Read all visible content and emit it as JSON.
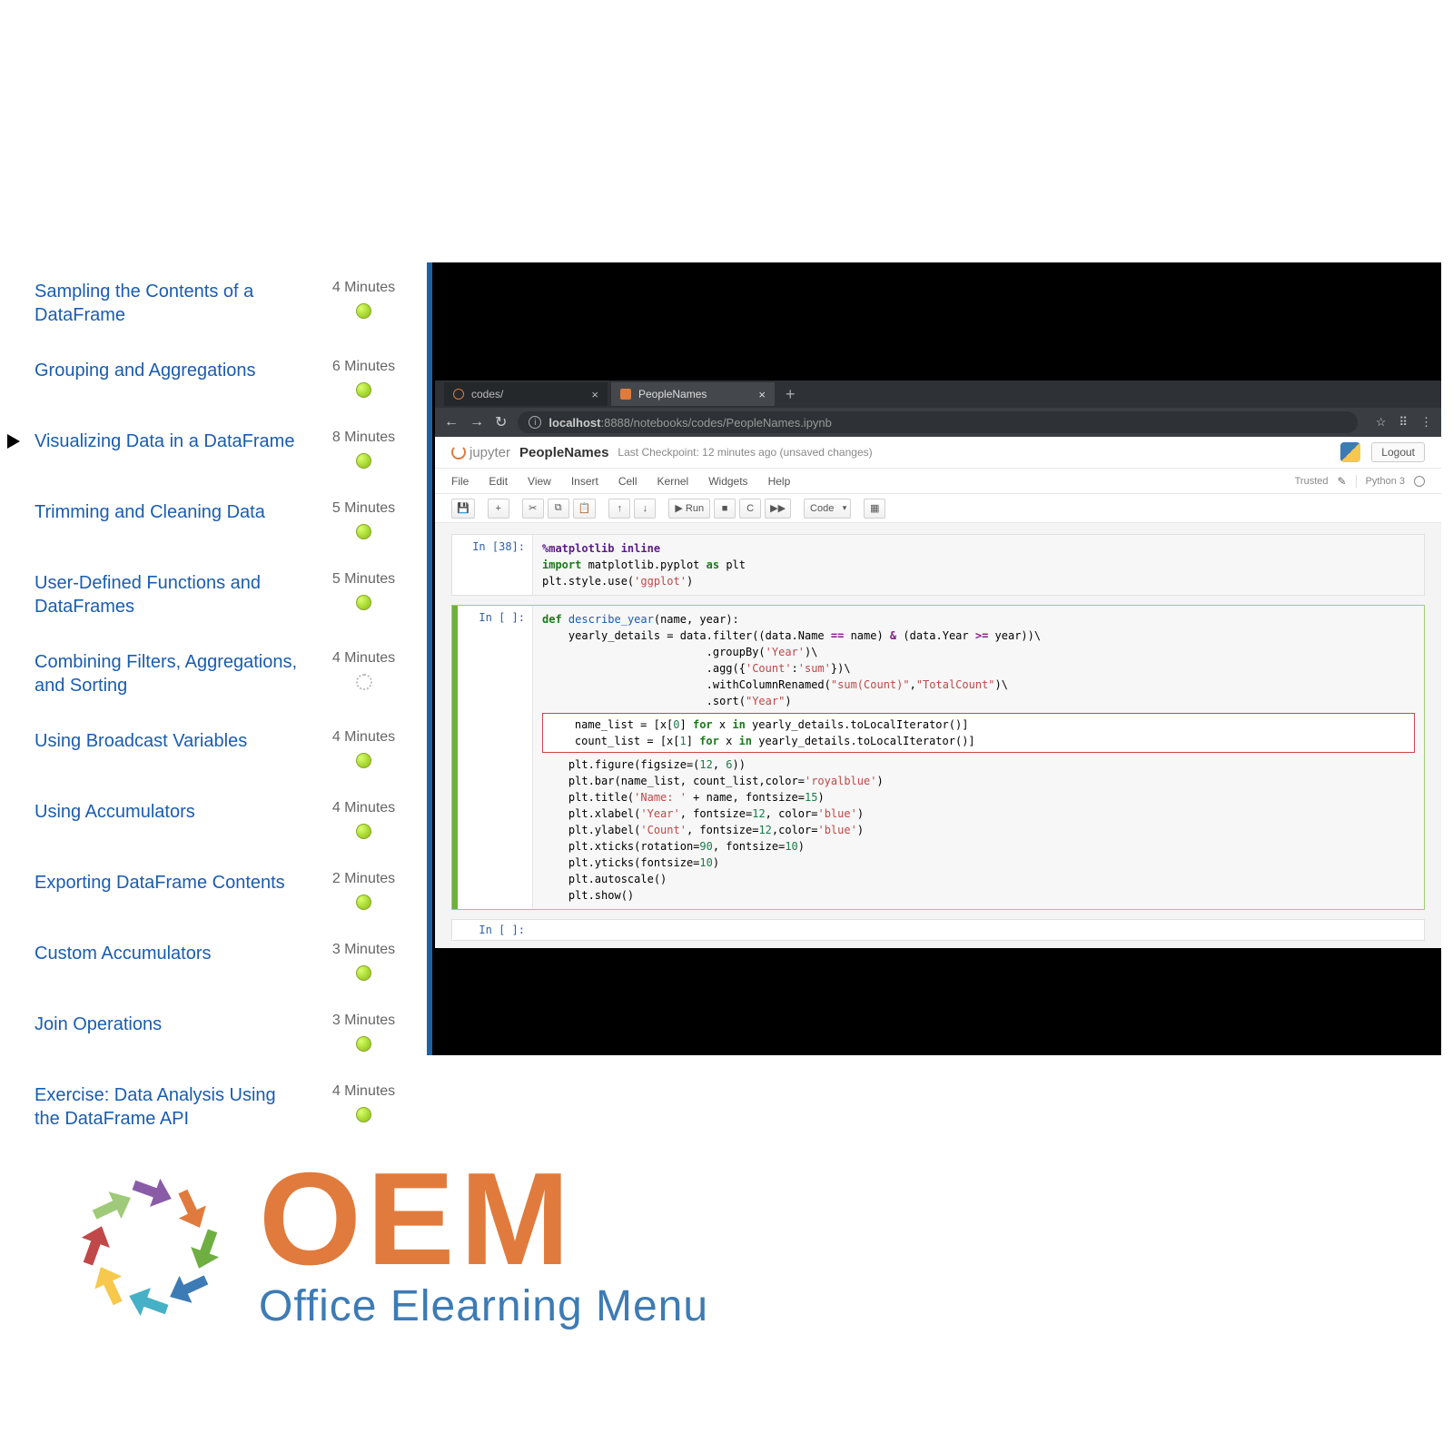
{
  "sidebar": {
    "items": [
      {
        "title": "Sampling the Contents of a DataFrame",
        "duration": "4 Minutes",
        "status": "done",
        "current": false
      },
      {
        "title": "Grouping and Aggregations",
        "duration": "6 Minutes",
        "status": "done",
        "current": false
      },
      {
        "title": "Visualizing Data in a DataFrame",
        "duration": "8 Minutes",
        "status": "done",
        "current": true
      },
      {
        "title": "Trimming and Cleaning Data",
        "duration": "5 Minutes",
        "status": "done",
        "current": false
      },
      {
        "title": "User-Defined Functions and DataFrames",
        "duration": "5 Minutes",
        "status": "done",
        "current": false
      },
      {
        "title": "Combining Filters, Aggregations, and Sorting",
        "duration": "4 Minutes",
        "status": "loading",
        "current": false
      },
      {
        "title": "Using Broadcast Variables",
        "duration": "4 Minutes",
        "status": "done",
        "current": false
      },
      {
        "title": "Using Accumulators",
        "duration": "4 Minutes",
        "status": "done",
        "current": false
      },
      {
        "title": "Exporting DataFrame Contents",
        "duration": "2 Minutes",
        "status": "done",
        "current": false
      },
      {
        "title": "Custom Accumulators",
        "duration": "3 Minutes",
        "status": "done",
        "current": false
      },
      {
        "title": "Join Operations",
        "duration": "3 Minutes",
        "status": "done",
        "current": false
      },
      {
        "title": "Exercise: Data Analysis Using the DataFrame API",
        "duration": "4 Minutes",
        "status": "done",
        "current": false
      }
    ]
  },
  "browser": {
    "tabs": [
      {
        "label": "codes/",
        "active": false
      },
      {
        "label": "PeopleNames",
        "active": true
      }
    ],
    "new_tab": "+",
    "nav": {
      "back": "←",
      "forward": "→",
      "reload": "↻"
    },
    "url_prefix": "localhost",
    "url_rest": ":8888/notebooks/codes/PeopleNames.ipynb",
    "star": "☆",
    "user": "⠿",
    "menu": "⋮"
  },
  "jupyter": {
    "logo": "jupyter",
    "title": "PeopleNames",
    "checkpoint": "Last Checkpoint: 12 minutes ago",
    "changes": "(unsaved changes)",
    "logout": "Logout",
    "menus": [
      "File",
      "Edit",
      "View",
      "Insert",
      "Cell",
      "Kernel",
      "Widgets",
      "Help"
    ],
    "trusted": "Trusted",
    "kernel": "Python 3",
    "toolbar": {
      "save": "💾",
      "add": "+",
      "cut": "✂",
      "copy": "⧉",
      "paste": "📋",
      "up": "↑",
      "down": "↓",
      "run": "▶ Run",
      "stop": "■",
      "restart": "C",
      "restart_run": "▶▶",
      "celltype": "Code",
      "palette": "▦"
    },
    "cells": [
      {
        "prompt": "In [38]:",
        "lines": [
          {
            "frag": [
              {
                "t": "%matplotlib inline",
                "c": "c-mag"
              }
            ]
          },
          {
            "frag": [
              {
                "t": "import",
                "c": "c-kw"
              },
              {
                "t": " matplotlib.pyplot "
              },
              {
                "t": "as",
                "c": "c-kw"
              },
              {
                "t": " plt"
              }
            ]
          },
          {
            "frag": [
              {
                "t": "plt.style.use("
              },
              {
                "t": "'ggplot'",
                "c": "c-str"
              },
              {
                "t": ")"
              }
            ]
          }
        ],
        "active": false
      },
      {
        "prompt": "In [ ]:",
        "active": true,
        "lines": [
          {
            "frag": [
              {
                "t": "def",
                "c": "c-kw"
              },
              {
                "t": " "
              },
              {
                "t": "describe_year",
                "c": "c-def"
              },
              {
                "t": "(name, year):"
              }
            ]
          },
          {
            "frag": [
              {
                "t": ""
              }
            ]
          },
          {
            "frag": [
              {
                "t": "    yearly_details = data.filter((data.Name "
              },
              {
                "t": "==",
                "c": "c-op"
              },
              {
                "t": " name) "
              },
              {
                "t": "&",
                "c": "c-op"
              },
              {
                "t": " (data.Year "
              },
              {
                "t": ">=",
                "c": "c-op"
              },
              {
                "t": " year))\\"
              }
            ]
          },
          {
            "frag": [
              {
                "t": "                         .groupBy("
              },
              {
                "t": "'Year'",
                "c": "c-str"
              },
              {
                "t": ")\\"
              }
            ]
          },
          {
            "frag": [
              {
                "t": "                         .agg({"
              },
              {
                "t": "'Count'",
                "c": "c-str"
              },
              {
                "t": ":"
              },
              {
                "t": "'sum'",
                "c": "c-str"
              },
              {
                "t": "})\\"
              }
            ]
          },
          {
            "frag": [
              {
                "t": "                         .withColumnRenamed("
              },
              {
                "t": "\"sum(Count)\"",
                "c": "c-str"
              },
              {
                "t": ","
              },
              {
                "t": "\"TotalCount\"",
                "c": "c-str"
              },
              {
                "t": ")\\"
              }
            ]
          },
          {
            "frag": [
              {
                "t": "                         .sort("
              },
              {
                "t": "\"Year\"",
                "c": "c-str"
              },
              {
                "t": ")"
              }
            ]
          },
          {
            "frag": [
              {
                "t": ""
              }
            ]
          },
          {
            "hl": true,
            "frag": [
              {
                "t": "    name_list = [x["
              },
              {
                "t": "0",
                "c": "c-num"
              },
              {
                "t": "] "
              },
              {
                "t": "for",
                "c": "c-kw"
              },
              {
                "t": " x "
              },
              {
                "t": "in",
                "c": "c-kw"
              },
              {
                "t": " yearly_details.toLocalIterator()]"
              }
            ]
          },
          {
            "hl": true,
            "frag": [
              {
                "t": "    count_list = [x["
              },
              {
                "t": "1",
                "c": "c-num"
              },
              {
                "t": "] "
              },
              {
                "t": "for",
                "c": "c-kw"
              },
              {
                "t": " x "
              },
              {
                "t": "in",
                "c": "c-kw"
              },
              {
                "t": " yearly_details.toLocalIterator()]"
              }
            ]
          },
          {
            "frag": [
              {
                "t": ""
              }
            ]
          },
          {
            "frag": [
              {
                "t": "    plt.figure(figsize=("
              },
              {
                "t": "12",
                "c": "c-num"
              },
              {
                "t": ", "
              },
              {
                "t": "6",
                "c": "c-num"
              },
              {
                "t": "))"
              }
            ]
          },
          {
            "frag": [
              {
                "t": "    plt.bar(name_list, count_list,color="
              },
              {
                "t": "'royalblue'",
                "c": "c-str"
              },
              {
                "t": ")"
              }
            ]
          },
          {
            "frag": [
              {
                "t": ""
              }
            ]
          },
          {
            "frag": [
              {
                "t": "    plt.title("
              },
              {
                "t": "'Name: '",
                "c": "c-str"
              },
              {
                "t": " + name, fontsize="
              },
              {
                "t": "15",
                "c": "c-num"
              },
              {
                "t": ")"
              }
            ]
          },
          {
            "frag": [
              {
                "t": "    plt.xlabel("
              },
              {
                "t": "'Year'",
                "c": "c-str"
              },
              {
                "t": ", fontsize="
              },
              {
                "t": "12",
                "c": "c-num"
              },
              {
                "t": ", color="
              },
              {
                "t": "'blue'",
                "c": "c-str"
              },
              {
                "t": ")"
              }
            ]
          },
          {
            "frag": [
              {
                "t": "    plt.ylabel("
              },
              {
                "t": "'Count'",
                "c": "c-str"
              },
              {
                "t": ", fontsize="
              },
              {
                "t": "12",
                "c": "c-num"
              },
              {
                "t": ",color="
              },
              {
                "t": "'blue'",
                "c": "c-str"
              },
              {
                "t": ")"
              }
            ]
          },
          {
            "frag": [
              {
                "t": ""
              }
            ]
          },
          {
            "frag": [
              {
                "t": "    plt.xticks(rotation="
              },
              {
                "t": "90",
                "c": "c-num"
              },
              {
                "t": ", fontsize="
              },
              {
                "t": "10",
                "c": "c-num"
              },
              {
                "t": ")"
              }
            ]
          },
          {
            "frag": [
              {
                "t": "    plt.yticks(fontsize="
              },
              {
                "t": "10",
                "c": "c-num"
              },
              {
                "t": ")"
              }
            ]
          },
          {
            "frag": [
              {
                "t": "    plt.autoscale()"
              }
            ]
          },
          {
            "frag": [
              {
                "t": "    plt.show()"
              }
            ]
          }
        ]
      }
    ],
    "partial_prompt": "In [ ]:"
  },
  "oem": {
    "title": "OEM",
    "subtitle": "Office Elearning Menu",
    "arrows": [
      {
        "c": "#8a5ca8",
        "r": 0
      },
      {
        "c": "#e07b3d",
        "r": 45
      },
      {
        "c": "#6fae41",
        "r": 90
      },
      {
        "c": "#3d7bb5",
        "r": 135
      },
      {
        "c": "#46b0c6",
        "r": 180
      },
      {
        "c": "#f6c84c",
        "r": 225
      },
      {
        "c": "#c04848",
        "r": 270
      },
      {
        "c": "#9fca7a",
        "r": 315
      }
    ]
  }
}
